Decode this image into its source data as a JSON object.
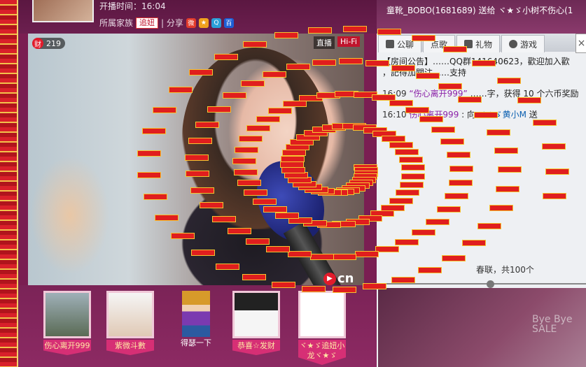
{
  "header": {
    "start_time": "开播时间：16:04",
    "family_label": "所属家族",
    "family_badge": "追妞",
    "share_label": "| 分享"
  },
  "video": {
    "wealth_icon": "财",
    "wealth_value": "219",
    "live_tag": "直播",
    "quality_tag": "Hi-Fi",
    "logo_text": "cn"
  },
  "fans": [
    {
      "name": "伤心离开999"
    },
    {
      "name": "紫微斗數"
    },
    {
      "name": "得瑟一下"
    },
    {
      "name": "恭喜☆发财"
    },
    {
      "name": "ヾ★ゞ追妞小龙ヾ★ゞ"
    }
  ],
  "chat_header": {
    "gift_notice": "童靴_BOBO(1681689) 送给 ヾ★ゞ小树不伤心(1"
  },
  "tabs": [
    {
      "label": "公聊"
    },
    {
      "label": "点歌"
    },
    {
      "label": "礼物"
    },
    {
      "label": "游戏"
    }
  ],
  "chat": {
    "msg1": "【房间公告】……QQ群141640623，歡迎加入歡",
    "msg2": "，記得加關注……支持",
    "msg3_time": "16:09",
    "msg3_user": "“伤心离开999”",
    "msg3_text": "……字，获得 10 个六币奖励",
    "msg4_time": "16:10",
    "msg4_user": "伤心离开999",
    "msg4_mid": ": 向",
    "msg4_target": "ヾ★ゞ黄小M",
    "msg4_action": "送",
    "spring_line": "春联，共100个"
  },
  "ad": {
    "text": "Bye Bye SALE"
  }
}
